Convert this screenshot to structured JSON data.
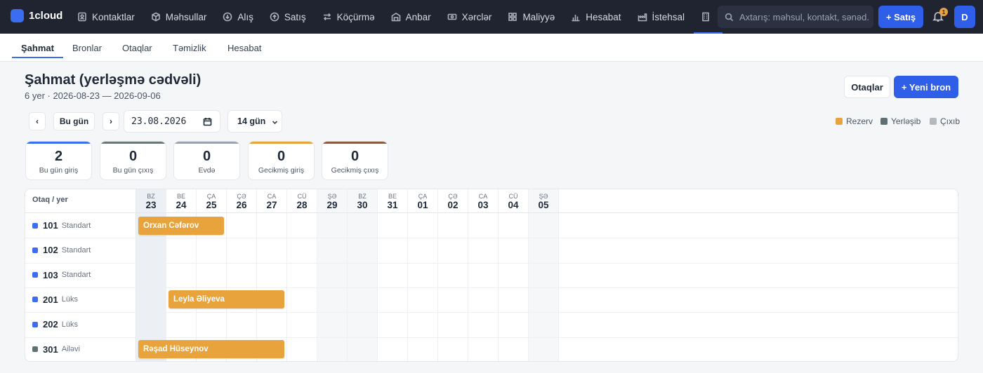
{
  "app": {
    "name": "1cloud"
  },
  "nav": {
    "items": [
      {
        "label": "Kontaktlar",
        "icon": "contacts-icon"
      },
      {
        "label": "Məhsullar",
        "icon": "box-icon"
      },
      {
        "label": "Alış",
        "icon": "download-circle-icon"
      },
      {
        "label": "Satış",
        "icon": "upload-circle-icon"
      },
      {
        "label": "Köçürmə",
        "icon": "transfer-icon"
      },
      {
        "label": "Anbar",
        "icon": "warehouse-icon"
      },
      {
        "label": "Xərclər",
        "icon": "cash-icon"
      },
      {
        "label": "Maliyyə",
        "icon": "grid-icon"
      },
      {
        "label": "Hesabat",
        "icon": "bar-chart-icon"
      },
      {
        "label": "İstehsal",
        "icon": "factory-icon"
      },
      {
        "label": "",
        "icon": "building-icon"
      }
    ]
  },
  "search": {
    "placeholder": "Axtarış: məhsul, kontakt, sənəd..."
  },
  "header_actions": {
    "sale_label": "+ Satış",
    "notifications_count": "1",
    "avatar_initial": "D"
  },
  "subtabs": [
    {
      "label": "Şahmat"
    },
    {
      "label": "Bronlar"
    },
    {
      "label": "Otaqlar"
    },
    {
      "label": "Təmizlik"
    },
    {
      "label": "Hesabat"
    }
  ],
  "page": {
    "title": "Şahmat (yerləşmə cədvəli)",
    "subtitle": "6 yer · 2026-08-23 — 2026-09-06",
    "rooms_button": "Otaqlar",
    "new_booking_button": "+ Yeni bron"
  },
  "toolbar": {
    "prev_label": "‹",
    "today_label": "Bu gün",
    "next_label": "›",
    "date_value": "23.08.2026",
    "range_value": "14 gün"
  },
  "legend": [
    {
      "label": "Rezerv",
      "color": "#e9a33d"
    },
    {
      "label": "Yerləşib",
      "color": "#5f7072"
    },
    {
      "label": "Çıxıb",
      "color": "#b4b8bf"
    }
  ],
  "stats": [
    {
      "value": "2",
      "label": "Bu gün giriş",
      "color": "#3b6df0"
    },
    {
      "value": "0",
      "label": "Bu gün çıxış",
      "color": "#6b7878"
    },
    {
      "value": "0",
      "label": "Evdə",
      "color": "#9ca3af"
    },
    {
      "value": "0",
      "label": "Gecikmiş giriş",
      "color": "#e9a33d"
    },
    {
      "value": "0",
      "label": "Gecikmiş çıxış",
      "color": "#8a5a44"
    }
  ],
  "grid": {
    "corner_label": "Otaq / yer",
    "days": [
      {
        "dow": "BZ",
        "num": "23"
      },
      {
        "dow": "BE",
        "num": "24"
      },
      {
        "dow": "ÇA",
        "num": "25"
      },
      {
        "dow": "ÇƏ",
        "num": "26"
      },
      {
        "dow": "CA",
        "num": "27"
      },
      {
        "dow": "CÜ",
        "num": "28"
      },
      {
        "dow": "ŞƏ",
        "num": "29"
      },
      {
        "dow": "BZ",
        "num": "30"
      },
      {
        "dow": "BE",
        "num": "31"
      },
      {
        "dow": "ÇA",
        "num": "01"
      },
      {
        "dow": "ÇƏ",
        "num": "02"
      },
      {
        "dow": "CA",
        "num": "03"
      },
      {
        "dow": "CÜ",
        "num": "04"
      },
      {
        "dow": "ŞƏ",
        "num": "05"
      }
    ],
    "rooms": [
      {
        "number": "101",
        "type": "Standart",
        "color": "#3b6df0"
      },
      {
        "number": "102",
        "type": "Standart",
        "color": "#3b6df0"
      },
      {
        "number": "103",
        "type": "Standart",
        "color": "#3b6df0"
      },
      {
        "number": "201",
        "type": "Lüks",
        "color": "#3b6df0"
      },
      {
        "number": "202",
        "type": "Lüks",
        "color": "#3b6df0"
      },
      {
        "number": "301",
        "type": "Ailəvi",
        "color": "#5f7072"
      }
    ],
    "bookings": [
      {
        "guest": "Orxan Cəfərov",
        "room": "101",
        "start": "23",
        "end": "25",
        "status": "Rezerv"
      },
      {
        "guest": "Leyla Əliyeva",
        "room": "201",
        "start": "24",
        "end": "27",
        "status": "Rezerv"
      },
      {
        "guest": "Rəşad Hüseynov",
        "room": "301",
        "start": "23",
        "end": "27",
        "status": "Rezerv"
      }
    ]
  }
}
